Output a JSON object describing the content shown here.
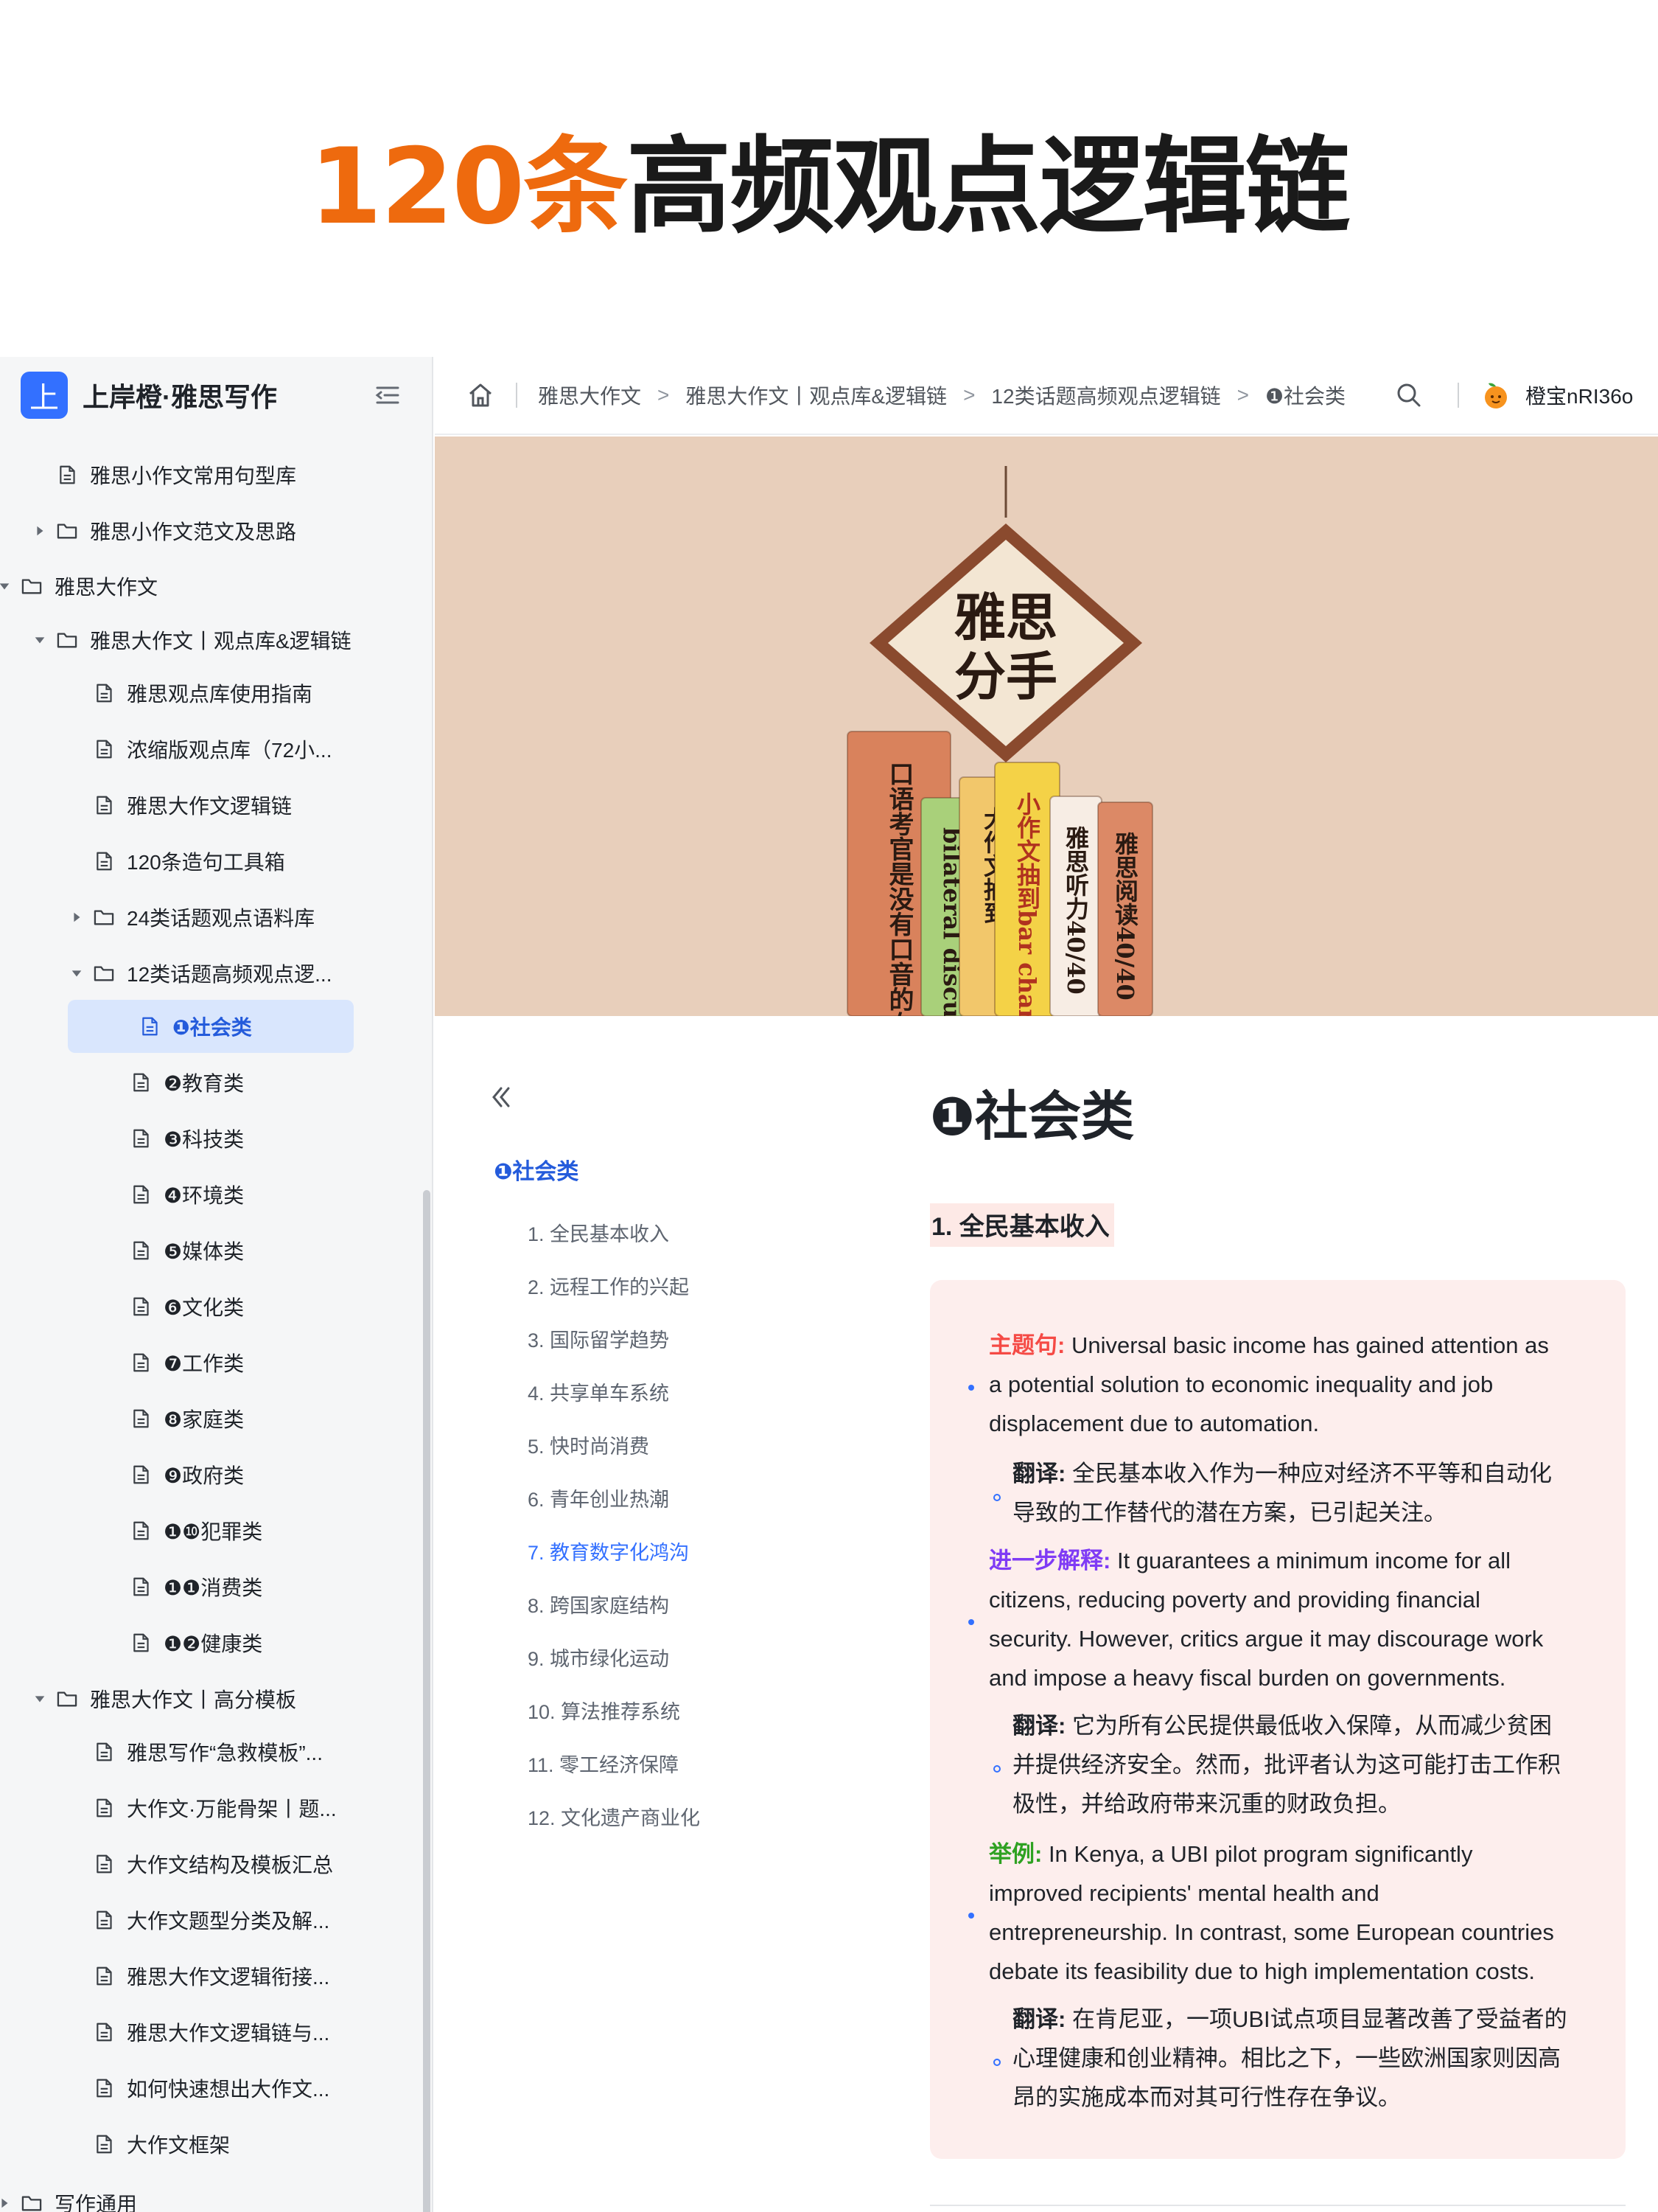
{
  "banner": {
    "highlight": "120条",
    "rest": "高频观点逻辑链"
  },
  "sidebar": {
    "logo_char": "上",
    "title": "上岸橙·雅思写作",
    "items": [
      {
        "label": "雅思小作文常用句型库",
        "type": "doc"
      },
      {
        "label": "雅思小作文范文及思路",
        "type": "folder",
        "state": "collapsed"
      },
      {
        "label": "雅思大作文",
        "type": "folder",
        "state": "expanded"
      },
      {
        "label": "雅思大作文丨观点库&逻辑链",
        "type": "folder",
        "state": "expanded"
      },
      {
        "label": "雅思观点库使用指南",
        "type": "doc"
      },
      {
        "label": "浓缩版观点库（72小...",
        "type": "doc"
      },
      {
        "label": "雅思大作文逻辑链",
        "type": "doc"
      },
      {
        "label": "120条造句工具箱",
        "type": "doc"
      },
      {
        "label": "24类话题观点语料库",
        "type": "folder",
        "state": "collapsed"
      },
      {
        "label": "12类话题高频观点逻...",
        "type": "folder",
        "state": "expanded"
      },
      {
        "label": "❶社会类",
        "type": "doc",
        "active": true
      },
      {
        "label": "❷教育类",
        "type": "doc"
      },
      {
        "label": "❸科技类",
        "type": "doc"
      },
      {
        "label": "❹环境类",
        "type": "doc"
      },
      {
        "label": "❺媒体类",
        "type": "doc"
      },
      {
        "label": "❻文化类",
        "type": "doc"
      },
      {
        "label": "❼工作类",
        "type": "doc"
      },
      {
        "label": "❽家庭类",
        "type": "doc"
      },
      {
        "label": "❾政府类",
        "type": "doc"
      },
      {
        "label": "❶❿犯罪类",
        "type": "doc"
      },
      {
        "label": "❶❶消费类",
        "type": "doc"
      },
      {
        "label": "❶❷健康类",
        "type": "doc"
      },
      {
        "label": "雅思大作文丨高分模板",
        "type": "folder",
        "state": "expanded"
      },
      {
        "label": "雅思写作“急救模板”...",
        "type": "doc"
      },
      {
        "label": "大作文·万能骨架丨题...",
        "type": "doc"
      },
      {
        "label": "大作文结构及模板汇总",
        "type": "doc"
      },
      {
        "label": "大作文题型分类及解...",
        "type": "doc"
      },
      {
        "label": "雅思大作文逻辑衔接...",
        "type": "doc"
      },
      {
        "label": "雅思大作文逻辑链与...",
        "type": "doc"
      },
      {
        "label": "如何快速想出大作文...",
        "type": "doc"
      },
      {
        "label": "大作文框架",
        "type": "doc"
      },
      {
        "label": "写作通用",
        "type": "folder",
        "state": "collapsed"
      }
    ]
  },
  "topbar": {
    "breadcrumbs": [
      "雅思大作文",
      "雅思大作文丨观点库&逻辑链",
      "12类话题高频观点逻辑链",
      "❶社会类"
    ],
    "separator": ">",
    "user_name": "橙宝nRI36o"
  },
  "cover": {
    "sign_text": [
      "雅思",
      "分手"
    ],
    "books": [
      {
        "text": "口语考官是没有口音的女菩萨",
        "color": "#d9825c"
      },
      {
        "text": "bilateral discussion",
        "color": "#a9d07a"
      },
      {
        "text": "大作文抽到",
        "color": "#f2c76b"
      },
      {
        "text": "小作文抽到bar chart",
        "color": "#f4d247"
      },
      {
        "text": "雅思听力40/40",
        "color": "#f7ede4"
      },
      {
        "text": "雅思阅读40/40",
        "color": "#dc8966"
      }
    ]
  },
  "toc": {
    "head": "❶社会类",
    "items": [
      {
        "label": "1. 全民基本收入"
      },
      {
        "label": "2. 远程工作的兴起"
      },
      {
        "label": "3. 国际留学趋势"
      },
      {
        "label": "4. 共享单车系统"
      },
      {
        "label": "5. 快时尚消费"
      },
      {
        "label": "6. 青年创业热潮"
      },
      {
        "label": "7. 教育数字化鸿沟",
        "current": true
      },
      {
        "label": "8. 跨国家庭结构"
      },
      {
        "label": "9. 城市绿化运动"
      },
      {
        "label": "10. 算法推荐系统"
      },
      {
        "label": "11. 零工经济保障"
      },
      {
        "label": "12. 文化遗产商业化"
      }
    ]
  },
  "doc": {
    "title": "❶社会类",
    "section_title": "1. 全民基本收入",
    "topic_label": "主题句:",
    "topic_line1": " Universal basic income has gained attention as",
    "topic_line2": "a potential solution to economic inequality and job",
    "topic_line3": "displacement due to automation.",
    "trans_label": "翻译:",
    "topic_trans1": " 全民基本收入作为一种应对经济不平等和自动化",
    "topic_trans2": "导致的工作替代的潜在方案，已引起关注。",
    "explain_label": "进一步解释:",
    "explain_line1": " It guarantees a minimum income for all",
    "explain_line2": "citizens, reducing poverty and providing financial",
    "explain_line3": "security. However, critics argue it may discourage work",
    "explain_line4": "and impose a heavy fiscal burden on governments.",
    "explain_trans1": " 它为所有公民提供最低收入保障，从而减少贫困",
    "explain_trans2": "并提供经济安全。然而，批评者认为这可能打击工作积",
    "explain_trans3": "极性，并给政府带来沉重的财政负担。",
    "example_label": "举例:",
    "example_line1": " In Kenya, a UBI pilot program significantly",
    "example_line2": "improved recipients' mental health and",
    "example_line3": "entrepreneurship. In contrast, some European countries",
    "example_line4": "debate its feasibility due to high implementation costs.",
    "example_trans1": " 在肯尼亚，一项UBI试点项目显著改善了受益者的",
    "example_trans2": "心理健康和创业精神。相比之下，一些欧洲国家则因高",
    "example_trans3": "昂的实施成本而对其可行性存在争议。"
  },
  "colors": {
    "accent": "#3370ff",
    "orange": "#ee6a0e",
    "callout_bg": "#fdeeed",
    "topic": "#f54a45",
    "explain": "#7f3bf5",
    "example": "#2ea121"
  }
}
